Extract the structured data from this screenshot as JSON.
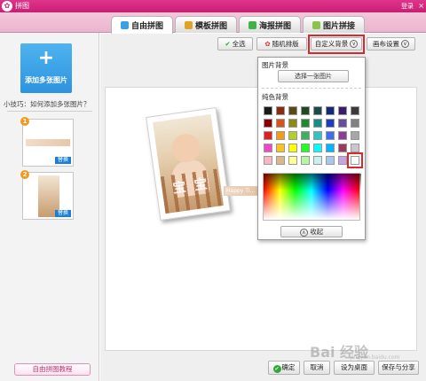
{
  "titlebar": {
    "title": "拼图",
    "login": "登录",
    "close": "×"
  },
  "tabs": [
    {
      "label": "自由拼图",
      "icon": "free-collage-icon",
      "active": true
    },
    {
      "label": "模板拼图",
      "icon": "template-icon",
      "active": false
    },
    {
      "label": "海报拼图",
      "icon": "poster-icon",
      "active": false
    },
    {
      "label": "图片拼接",
      "icon": "stitch-icon",
      "active": false
    }
  ],
  "sidebar": {
    "add_plus": "+",
    "add_label": "添加多张图片",
    "tip": "小技巧：如何添加多张图片？",
    "thumbs": [
      {
        "num": "1",
        "replace": "替换"
      },
      {
        "num": "2",
        "replace": "替换"
      }
    ],
    "tutorial": "自由拼图教程"
  },
  "toolbar": {
    "select_all": "全选",
    "random_layout": "随机排版",
    "custom_bg": "自定义背景",
    "canvas_settings": "画布设置"
  },
  "dropdown": {
    "image_bg_title": "图片背景",
    "choose_image": "选择一张图片",
    "solid_bg_title": "纯色背景",
    "collapse": "收起",
    "swatch_colors": [
      [
        "#1a1a1a",
        "#8b2a0e",
        "#5a4a10",
        "#1e4a1e",
        "#1b4a4a",
        "#132a7a",
        "#3a1d6e",
        "#3a3a3a"
      ],
      [
        "#8b0000",
        "#d9531e",
        "#8a8a14",
        "#1f8a2e",
        "#1a8a8a",
        "#1d3fbf",
        "#6a4c9c",
        "#808080"
      ],
      [
        "#e02020",
        "#f49a1c",
        "#b5cf22",
        "#3bb05e",
        "#31c2c8",
        "#3c6ef0",
        "#8a3c96",
        "#a6a6a6"
      ],
      [
        "#f046c8",
        "#ffc21c",
        "#ffff00",
        "#1fff1f",
        "#00ffff",
        "#00b7ff",
        "#9c3a5e",
        "#c8c8c8"
      ],
      [
        "#f9b6c5",
        "#d9b98a",
        "#ffff99",
        "#b6f7a6",
        "#c8f0f0",
        "#a9c6ee",
        "#c2a6e0",
        "#ffffff"
      ]
    ]
  },
  "canvas": {
    "photo_text": "宝 宝",
    "strip_text": "Happy Ti..."
  },
  "bottom": {
    "ok": "确定",
    "cancel": "取消",
    "desktop": "设为桌面",
    "save_share": "保存与分享"
  },
  "watermark": {
    "main": "Bai 经验",
    "sub": "jingyan.baidu.com"
  }
}
